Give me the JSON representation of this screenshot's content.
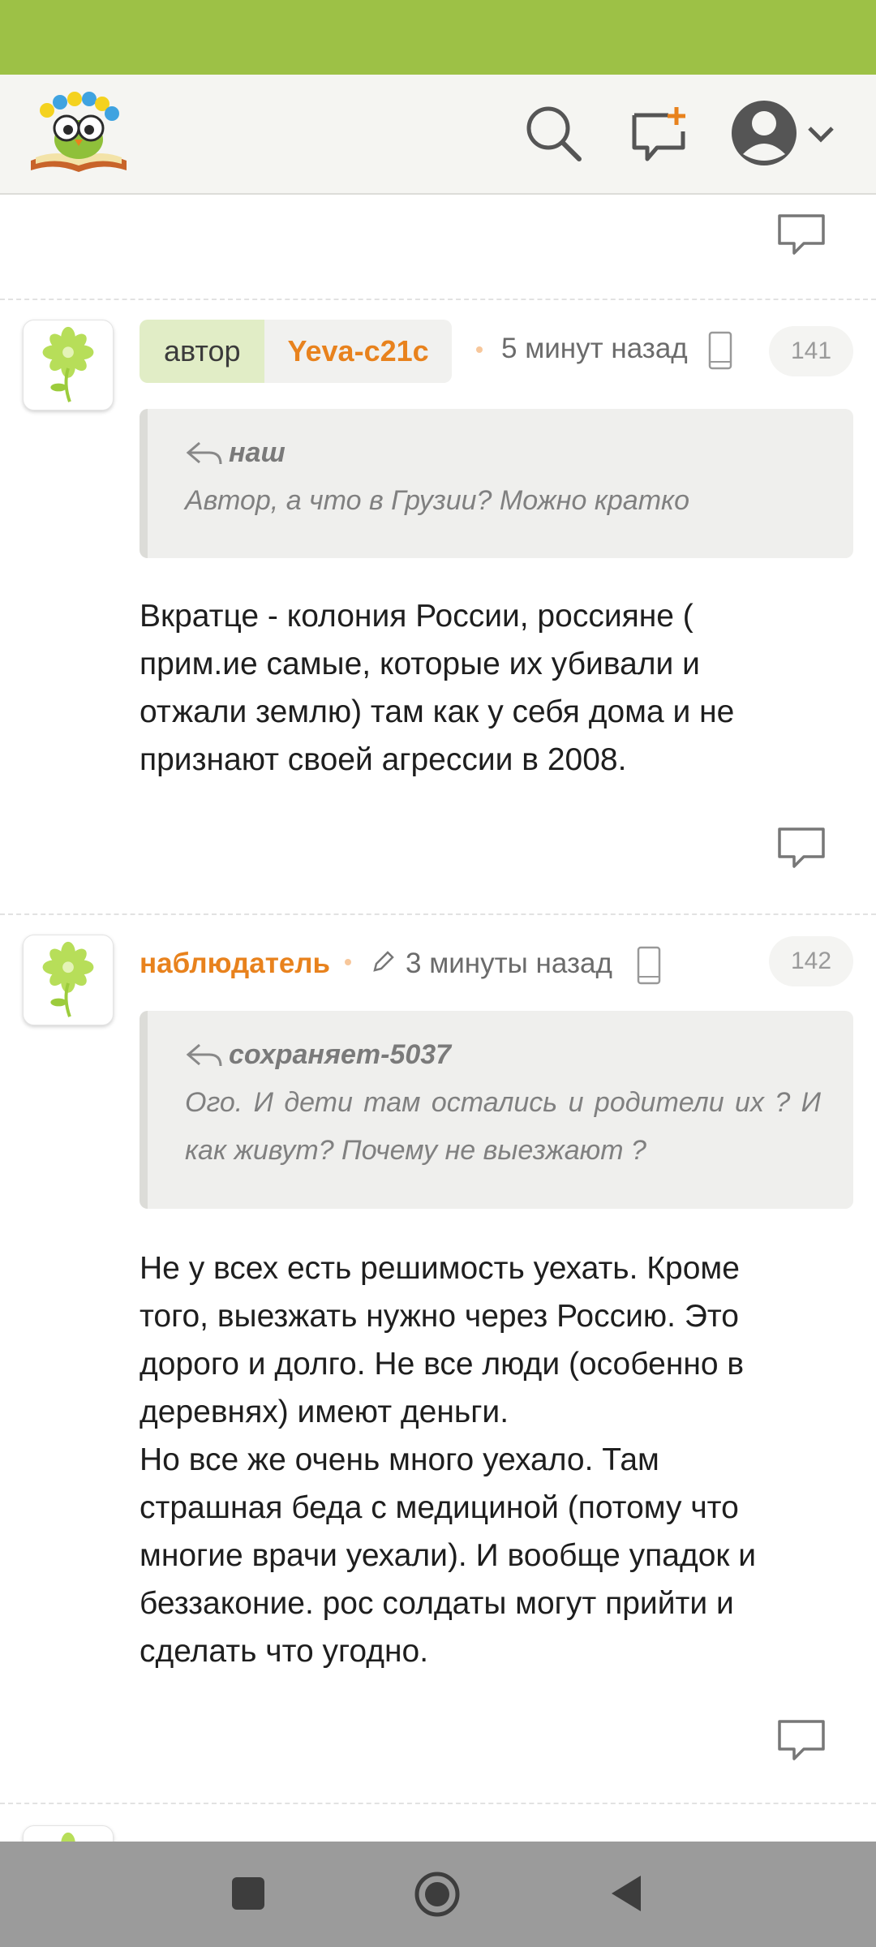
{
  "colors": {
    "status_bar": "#9dc146",
    "accent": "#e8821d",
    "author_chip": "#e1edc6",
    "nav_bar": "#9b9b9b"
  },
  "header": {
    "logo": "owl-on-book-logo",
    "icons": [
      "search-icon",
      "new-post-icon",
      "profile-avatar-icon",
      "chevron-down-icon"
    ]
  },
  "posts": [
    {
      "role_label": "автор",
      "author": "Yeva-c21c",
      "time": "5 минут назад",
      "number": "141",
      "quote": {
        "author": "наш",
        "text": "Автор, а что в Грузии? Можно кратко"
      },
      "text": "Вкратце - колония России, россияне (\nприм.ие самые, которые их убивали и\nотжали землю) там как у себя дома и не\nпризнают своей агрессии в 2008."
    },
    {
      "author": "наблюдатель",
      "time": "3 минуты назад",
      "number": "142",
      "quote": {
        "author": "сохраняет-5037",
        "text": "Ого. И дети там остались и родители их ? И как живут? Почему не выезжают ?"
      },
      "text": "Не у всех есть решимость уехать. Кроме\nтого, выезжать нужно через Россию. Это\nдорого и долго. Не все люди (особенно в\nдеревнях) имеют деньги.\nНо все же очень много уехало. Там\nстрашная беда с медициной (потому что\nмногие врачи уехали). И вообще упадок и\nбеззаконие. рос солдаты могут прийти и\nсделать что угодно."
    }
  ],
  "navigation": {
    "buttons": [
      "recents-button",
      "home-button",
      "back-button"
    ]
  }
}
